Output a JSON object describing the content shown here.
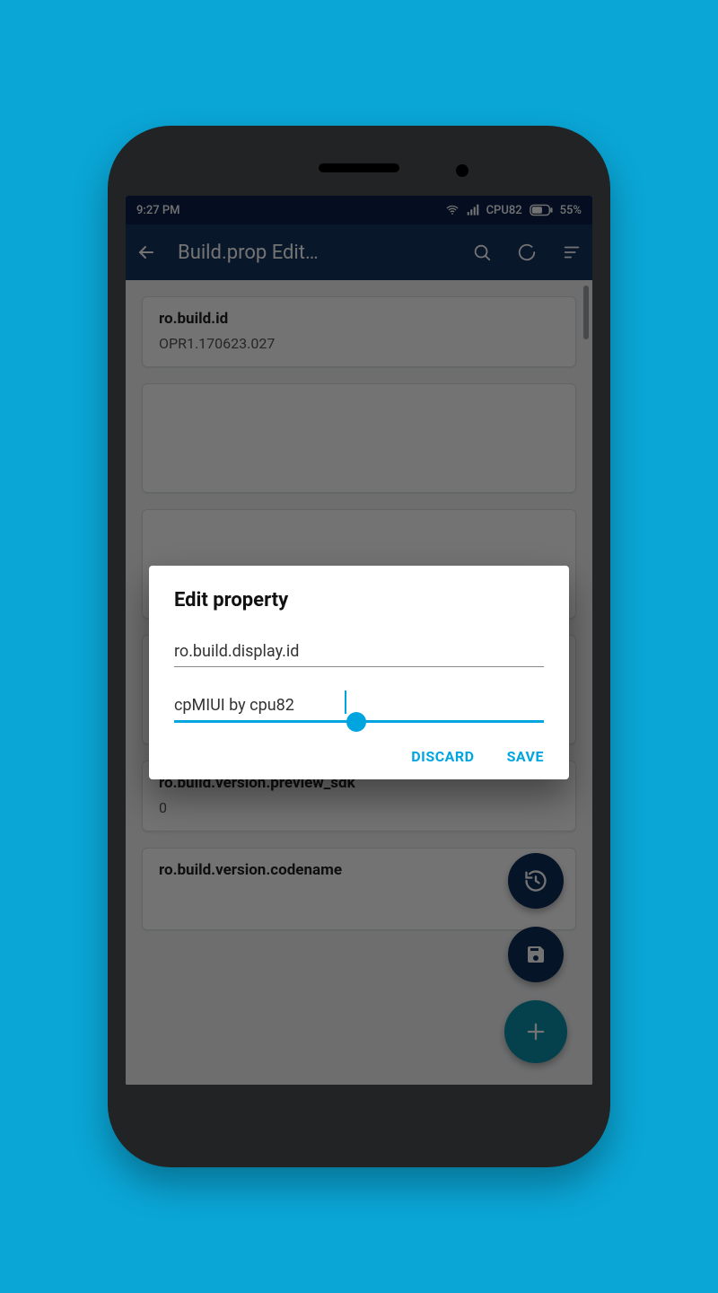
{
  "status": {
    "time": "9:27 PM",
    "cpu_label": "CPU82",
    "battery_pct": "55%"
  },
  "appbar": {
    "title": "Build.prop Edit…"
  },
  "list": [
    {
      "key": "ro.build.id",
      "value": "OPR1.170623.027"
    },
    {
      "key": "",
      "value": ""
    },
    {
      "key": "",
      "value": ""
    },
    {
      "key": "",
      "value": ""
    },
    {
      "key": "ro.build.version.preview_sdk",
      "value": "0"
    },
    {
      "key": "ro.build.version.codename",
      "value": ""
    }
  ],
  "dialog": {
    "title": "Edit property",
    "field1_value": "ro.build.display.id",
    "field2_value": "cpMIUI by cpu82",
    "discard_label": "DISCARD",
    "save_label": "SAVE"
  }
}
